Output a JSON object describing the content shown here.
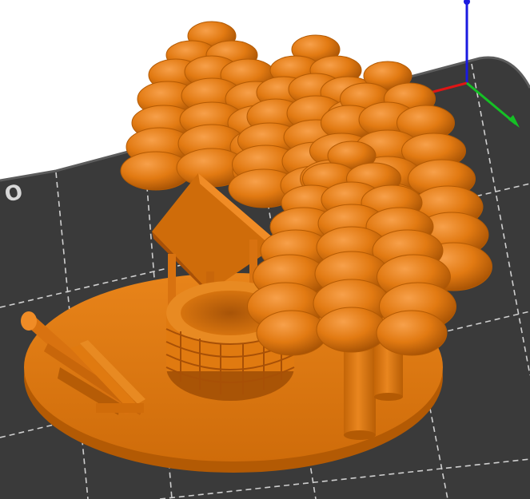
{
  "viewport": {
    "background": "#ffffff",
    "bed_color": "#3a3a3a",
    "bed_edge_color": "#5a5a5a",
    "grid_color": "#d0d0d0",
    "bed_label": "O"
  },
  "axes": {
    "x_color": "#e01010",
    "y_color": "#10c020",
    "z_color": "#1010e0"
  },
  "model": {
    "color": "#e07a10",
    "shade_color": "#b85e05",
    "highlight_color": "#f59a3a"
  }
}
